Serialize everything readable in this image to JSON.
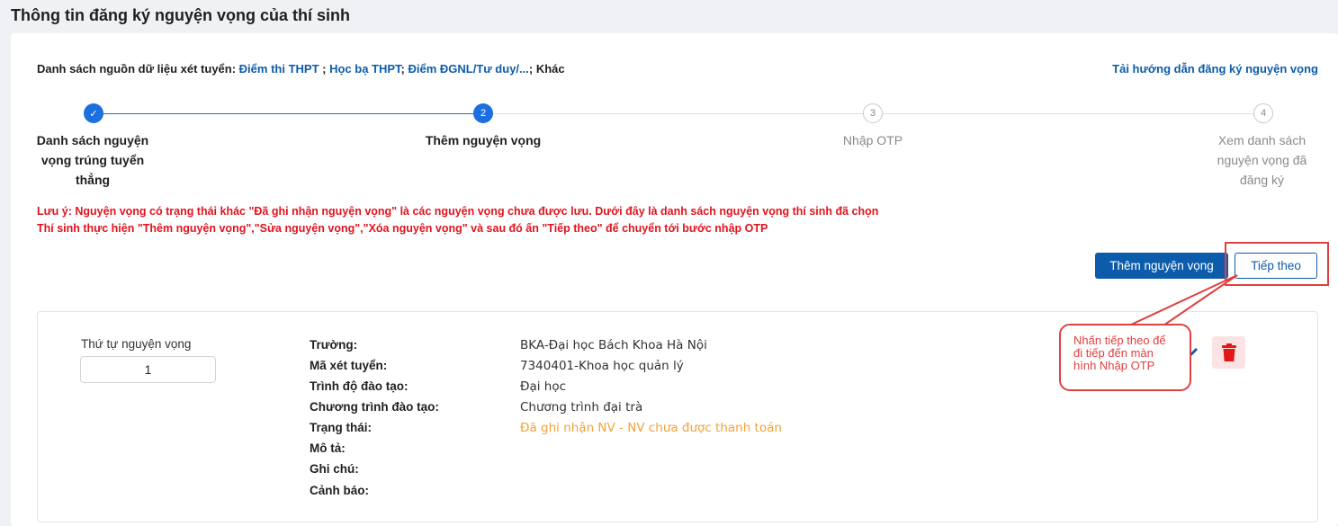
{
  "page": {
    "title": "Thông tin đăng ký nguyện vọng của thí sinh"
  },
  "sources": {
    "label": "Danh sách nguồn dữ liệu xét tuyển:",
    "items": [
      "Điểm thi THPT",
      "Học bạ THPT",
      "Điểm ĐGNL/Tư duy/..."
    ],
    "other": "Khác",
    "guide_link": "Tải hướng dẫn đăng ký nguyện vọng"
  },
  "stepper": {
    "steps": [
      {
        "number": "✓",
        "label": "Danh sách nguyện vọng trúng tuyển thẳng",
        "state": "done"
      },
      {
        "number": "2",
        "label": "Thêm nguyện vọng",
        "state": "active"
      },
      {
        "number": "3",
        "label": "Nhập OTP",
        "state": "future"
      },
      {
        "number": "4",
        "label": "Xem danh sách nguyện vọng đã đăng ký",
        "state": "future"
      }
    ]
  },
  "notes": {
    "line1": "Lưu ý: Nguyện vọng có trạng thái khác \"Đã ghi nhận nguyện vọng\" là các nguyện vọng chưa được lưu. Dưới đây là danh sách nguyện vọng thí sinh đã chọn",
    "line2": "Thí sinh thực hiện \"Thêm nguyện vọng\",\"Sửa nguyện vọng\",\"Xóa nguyện vọng\" và sau đó ấn \"Tiếp theo\" để chuyển tới bước nhập OTP"
  },
  "actions": {
    "add_label": "Thêm nguyện vọng",
    "next_label": "Tiếp theo"
  },
  "record": {
    "order_label": "Thứ tự nguyện vọng",
    "order_value": "1",
    "fields": [
      {
        "label": "Trường:",
        "value": "BKA-Đại học Bách Khoa Hà Nội"
      },
      {
        "label": "Mã xét tuyển:",
        "value": "7340401-Khoa học quản lý"
      },
      {
        "label": "Trình độ đào tạo:",
        "value": "Đại học"
      },
      {
        "label": "Chương trình đào tạo:",
        "value": "Chương trình đại trà"
      },
      {
        "label": "Trạng thái:",
        "value": "Đã ghi nhận NV - NV chưa được thanh toán"
      },
      {
        "label": "Mô tả:",
        "value": ""
      },
      {
        "label": "Ghi chú:",
        "value": ""
      },
      {
        "label": "Cảnh báo:",
        "value": ""
      }
    ]
  },
  "callout": {
    "line1": "Nhấn tiếp theo để",
    "line2": "đi tiếp đến màn",
    "line3": "hình Nhập OTP"
  },
  "colors": {
    "primary": "#0d5cab",
    "step_active": "#1c6fe0",
    "warning_text": "#e0141e",
    "status_text": "#f2a33a",
    "annotation": "#e04040"
  }
}
